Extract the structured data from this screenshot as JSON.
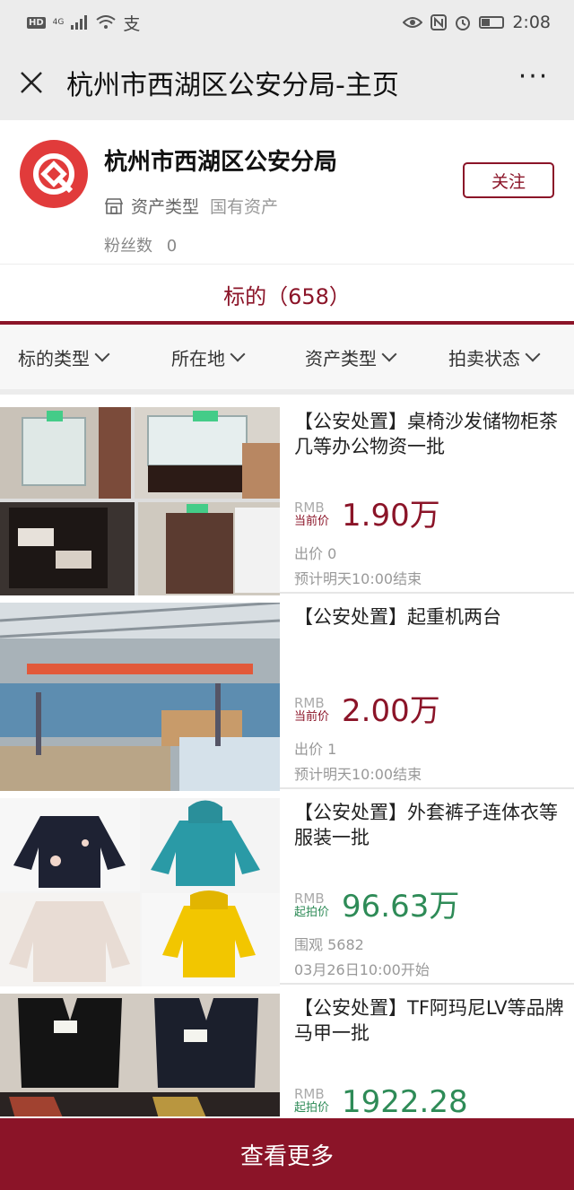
{
  "status_bar": {
    "hd": "HD",
    "signal": "4G",
    "alipay": "支",
    "time": "2:08"
  },
  "nav": {
    "title": "杭州市西湖区公安分局-主页",
    "more": "···"
  },
  "profile": {
    "name": "杭州市西湖区公安分局",
    "asset_type_label": "资产类型",
    "asset_type_value": "国有资产",
    "fans_label": "粉丝数",
    "fans_count": "0",
    "follow_label": "关注"
  },
  "tab": {
    "label": "标的（658）"
  },
  "filters": [
    {
      "label": "标的类型"
    },
    {
      "label": "所在地"
    },
    {
      "label": "资产类型"
    },
    {
      "label": "拍卖状态"
    }
  ],
  "items": [
    {
      "title": "【公安处置】桌椅沙发储物柜茶几等办公物资一批",
      "currency": "RMB",
      "price_label": "当前价",
      "price": "1.90万",
      "meta1": "出价 0",
      "meta2": "预计明天10:00结束",
      "status_color": "#8b1428"
    },
    {
      "title": "【公安处置】起重机两台",
      "currency": "RMB",
      "price_label": "当前价",
      "price": "2.00万",
      "meta1": "出价 1",
      "meta2": "预计明天10:00结束",
      "status_color": "#8b1428"
    },
    {
      "title": "【公安处置】外套裤子连体衣等服装一批",
      "currency": "RMB",
      "price_label": "起拍价",
      "price": "96.63万",
      "meta1": "围观 5682",
      "meta2": "03月26日10:00开始",
      "status_color": "#2e8b57"
    },
    {
      "title": "【公安处置】TF阿玛尼LV等品牌马甲一批",
      "currency": "RMB",
      "price_label": "起拍价",
      "price": "1922.28",
      "meta1": "",
      "meta2": "",
      "status_color": "#2e8b57"
    }
  ],
  "bottom_button": {
    "label": "查看更多"
  }
}
